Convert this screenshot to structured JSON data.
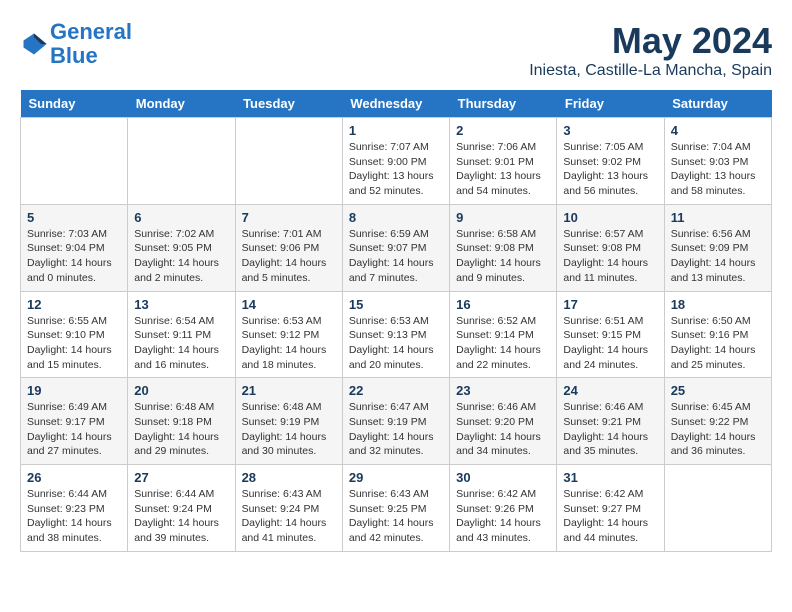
{
  "logo": {
    "line1": "General",
    "line2": "Blue"
  },
  "title": "May 2024",
  "subtitle": "Iniesta, Castille-La Mancha, Spain",
  "days_of_week": [
    "Sunday",
    "Monday",
    "Tuesday",
    "Wednesday",
    "Thursday",
    "Friday",
    "Saturday"
  ],
  "weeks": [
    [
      {
        "day": "",
        "detail": ""
      },
      {
        "day": "",
        "detail": ""
      },
      {
        "day": "",
        "detail": ""
      },
      {
        "day": "1",
        "detail": "Sunrise: 7:07 AM\nSunset: 9:00 PM\nDaylight: 13 hours and 52 minutes."
      },
      {
        "day": "2",
        "detail": "Sunrise: 7:06 AM\nSunset: 9:01 PM\nDaylight: 13 hours and 54 minutes."
      },
      {
        "day": "3",
        "detail": "Sunrise: 7:05 AM\nSunset: 9:02 PM\nDaylight: 13 hours and 56 minutes."
      },
      {
        "day": "4",
        "detail": "Sunrise: 7:04 AM\nSunset: 9:03 PM\nDaylight: 13 hours and 58 minutes."
      }
    ],
    [
      {
        "day": "5",
        "detail": "Sunrise: 7:03 AM\nSunset: 9:04 PM\nDaylight: 14 hours and 0 minutes."
      },
      {
        "day": "6",
        "detail": "Sunrise: 7:02 AM\nSunset: 9:05 PM\nDaylight: 14 hours and 2 minutes."
      },
      {
        "day": "7",
        "detail": "Sunrise: 7:01 AM\nSunset: 9:06 PM\nDaylight: 14 hours and 5 minutes."
      },
      {
        "day": "8",
        "detail": "Sunrise: 6:59 AM\nSunset: 9:07 PM\nDaylight: 14 hours and 7 minutes."
      },
      {
        "day": "9",
        "detail": "Sunrise: 6:58 AM\nSunset: 9:08 PM\nDaylight: 14 hours and 9 minutes."
      },
      {
        "day": "10",
        "detail": "Sunrise: 6:57 AM\nSunset: 9:08 PM\nDaylight: 14 hours and 11 minutes."
      },
      {
        "day": "11",
        "detail": "Sunrise: 6:56 AM\nSunset: 9:09 PM\nDaylight: 14 hours and 13 minutes."
      }
    ],
    [
      {
        "day": "12",
        "detail": "Sunrise: 6:55 AM\nSunset: 9:10 PM\nDaylight: 14 hours and 15 minutes."
      },
      {
        "day": "13",
        "detail": "Sunrise: 6:54 AM\nSunset: 9:11 PM\nDaylight: 14 hours and 16 minutes."
      },
      {
        "day": "14",
        "detail": "Sunrise: 6:53 AM\nSunset: 9:12 PM\nDaylight: 14 hours and 18 minutes."
      },
      {
        "day": "15",
        "detail": "Sunrise: 6:53 AM\nSunset: 9:13 PM\nDaylight: 14 hours and 20 minutes."
      },
      {
        "day": "16",
        "detail": "Sunrise: 6:52 AM\nSunset: 9:14 PM\nDaylight: 14 hours and 22 minutes."
      },
      {
        "day": "17",
        "detail": "Sunrise: 6:51 AM\nSunset: 9:15 PM\nDaylight: 14 hours and 24 minutes."
      },
      {
        "day": "18",
        "detail": "Sunrise: 6:50 AM\nSunset: 9:16 PM\nDaylight: 14 hours and 25 minutes."
      }
    ],
    [
      {
        "day": "19",
        "detail": "Sunrise: 6:49 AM\nSunset: 9:17 PM\nDaylight: 14 hours and 27 minutes."
      },
      {
        "day": "20",
        "detail": "Sunrise: 6:48 AM\nSunset: 9:18 PM\nDaylight: 14 hours and 29 minutes."
      },
      {
        "day": "21",
        "detail": "Sunrise: 6:48 AM\nSunset: 9:19 PM\nDaylight: 14 hours and 30 minutes."
      },
      {
        "day": "22",
        "detail": "Sunrise: 6:47 AM\nSunset: 9:19 PM\nDaylight: 14 hours and 32 minutes."
      },
      {
        "day": "23",
        "detail": "Sunrise: 6:46 AM\nSunset: 9:20 PM\nDaylight: 14 hours and 34 minutes."
      },
      {
        "day": "24",
        "detail": "Sunrise: 6:46 AM\nSunset: 9:21 PM\nDaylight: 14 hours and 35 minutes."
      },
      {
        "day": "25",
        "detail": "Sunrise: 6:45 AM\nSunset: 9:22 PM\nDaylight: 14 hours and 36 minutes."
      }
    ],
    [
      {
        "day": "26",
        "detail": "Sunrise: 6:44 AM\nSunset: 9:23 PM\nDaylight: 14 hours and 38 minutes."
      },
      {
        "day": "27",
        "detail": "Sunrise: 6:44 AM\nSunset: 9:24 PM\nDaylight: 14 hours and 39 minutes."
      },
      {
        "day": "28",
        "detail": "Sunrise: 6:43 AM\nSunset: 9:24 PM\nDaylight: 14 hours and 41 minutes."
      },
      {
        "day": "29",
        "detail": "Sunrise: 6:43 AM\nSunset: 9:25 PM\nDaylight: 14 hours and 42 minutes."
      },
      {
        "day": "30",
        "detail": "Sunrise: 6:42 AM\nSunset: 9:26 PM\nDaylight: 14 hours and 43 minutes."
      },
      {
        "day": "31",
        "detail": "Sunrise: 6:42 AM\nSunset: 9:27 PM\nDaylight: 14 hours and 44 minutes."
      },
      {
        "day": "",
        "detail": ""
      }
    ]
  ]
}
